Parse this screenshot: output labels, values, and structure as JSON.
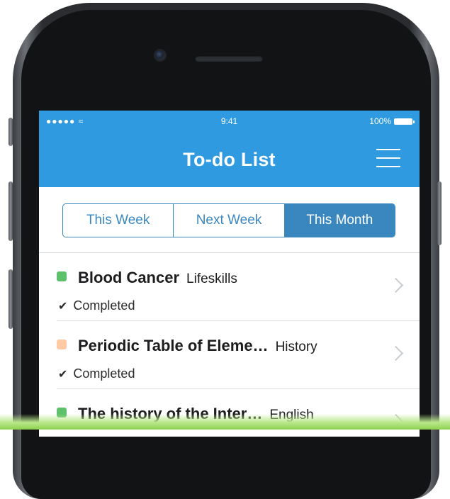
{
  "status_bar": {
    "signal": "●●●●● ≈",
    "time": "9:41",
    "battery": "100%"
  },
  "header": {
    "title": "To-do List"
  },
  "tabs": [
    {
      "label": "This Week",
      "active": false
    },
    {
      "label": "Next Week",
      "active": false
    },
    {
      "label": "This Month",
      "active": true
    }
  ],
  "items": [
    {
      "title": "Blood Cancer",
      "subject": "Lifeskills",
      "status": "Completed",
      "color": "#5fc06b"
    },
    {
      "title": "Periodic Table of Eleme…",
      "subject": "History",
      "status": "Completed",
      "color": "#ffc9a3"
    },
    {
      "title": "The history of the Inter…",
      "subject": "English",
      "status": "",
      "color": "#5fc06b"
    }
  ],
  "colors": {
    "nav": "#2f9ae0",
    "segment": "#3a87bf",
    "glow": "#9ad85e"
  },
  "icons": {
    "menu": "hamburger-menu-icon",
    "check": "checkmark-icon",
    "chevron": "chevron-right-icon",
    "wifi": "wifi-icon",
    "battery": "battery-icon"
  }
}
